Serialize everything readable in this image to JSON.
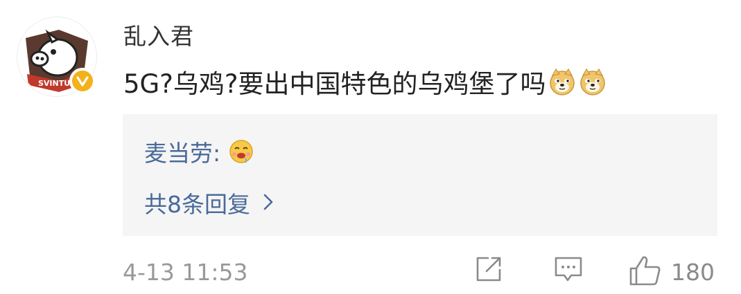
{
  "comment": {
    "username": "乱入君",
    "text": "5G?乌鸡?要出中国特色的乌鸡堡了吗",
    "emojis": [
      "doge-emoji",
      "doge-emoji"
    ],
    "timestamp": "4-13 11:53"
  },
  "reply_preview": {
    "author": "麦当劳:",
    "emoji": "drooling-emoji",
    "more_replies_label": "共8条回复"
  },
  "actions": {
    "like_count": "180"
  },
  "colors": {
    "link_blue": "#4a6a9a",
    "verified_badge": "#f3b11a",
    "reply_background": "#f5f5f5"
  }
}
